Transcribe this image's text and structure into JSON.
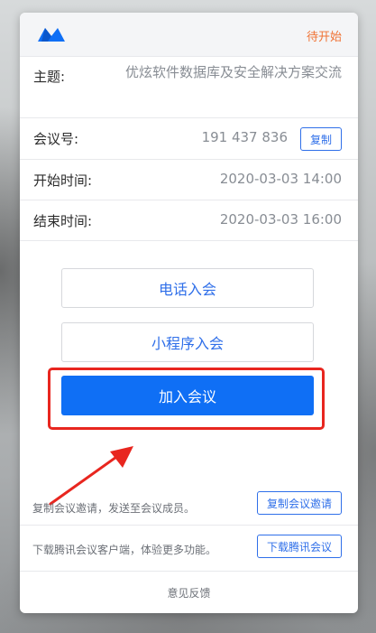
{
  "header": {
    "status": "待开始",
    "logo_icon": "tencent-meeting-logo-icon",
    "status_color": "#f07335"
  },
  "meeting": {
    "topic_label": "主题:",
    "topic_value": "优炫软件数据库及安全解决方案交流",
    "id_label": "会议号:",
    "id_value": "191 437 836",
    "copy_label": "复制",
    "start_label": "开始时间:",
    "start_value": "2020-03-03 14:00",
    "end_label": "结束时间:",
    "end_value": "2020-03-03 16:00"
  },
  "actions": {
    "phone_join": "电话入会",
    "miniprogram_join": "小程序入会",
    "join_meeting": "加入会议"
  },
  "footer": {
    "invite_text": "复制会议邀请，发送至会议成员。",
    "invite_button": "复制会议邀请",
    "download_text": "下载腾讯会议客户端，体验更多功能。",
    "download_button": "下载腾讯会议",
    "feedback": "意见反馈"
  },
  "colors": {
    "accent": "#0f6ff5",
    "link": "#2f6fe9",
    "highlight": "#e8261f"
  }
}
